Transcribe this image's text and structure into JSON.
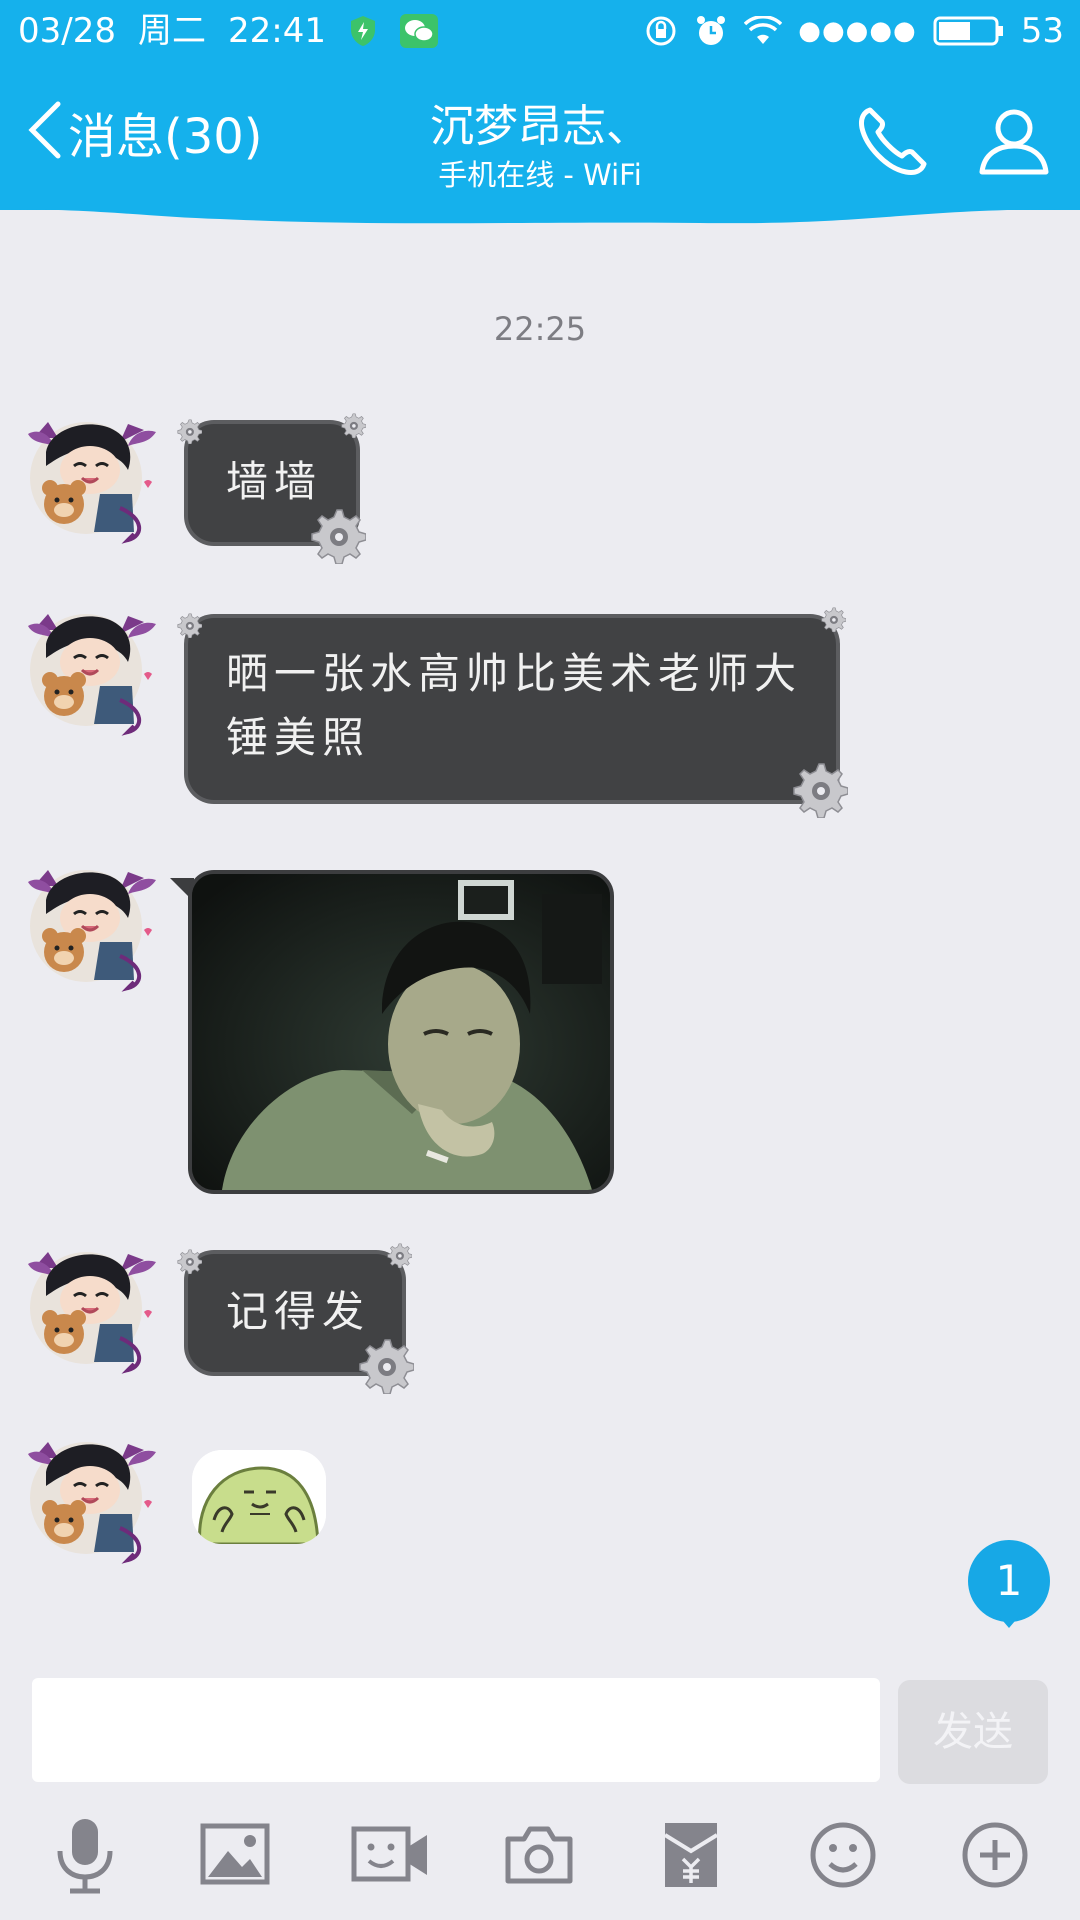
{
  "status_bar": {
    "date": "03/28",
    "weekday": "周二",
    "time": "22:41",
    "signal_dots": "●●●●●",
    "battery_level": "53"
  },
  "header": {
    "back_label": "消息(30)",
    "contact_name": "沉梦昂志、",
    "contact_status": "手机在线 - WiFi",
    "accent_color": "#15b1ec"
  },
  "chat": {
    "timestamp": "22:25",
    "messages": [
      {
        "type": "text",
        "text": "墙墙"
      },
      {
        "type": "text",
        "lines": [
          "晒一张水高帅比美术老师大",
          "锤美照"
        ]
      },
      {
        "type": "image"
      },
      {
        "type": "text",
        "text": "记得发"
      },
      {
        "type": "sticker"
      }
    ],
    "unread_badge": "1"
  },
  "composer": {
    "input_value": "",
    "send_label": "发送"
  },
  "toolbar_icons": [
    "microphone-icon",
    "image-icon",
    "video-call-icon",
    "camera-icon",
    "red-packet-icon",
    "emoji-icon",
    "plus-icon"
  ]
}
